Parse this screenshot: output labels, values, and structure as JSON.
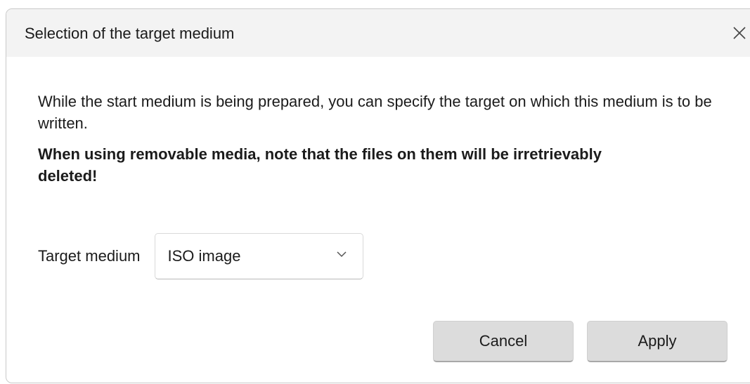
{
  "dialog": {
    "title": "Selection of the target medium",
    "close_icon": "close-icon"
  },
  "content": {
    "info_text": "While the start medium is being prepared, you can specify the target on which this medium is to be written.",
    "warning_text": "When using removable media, note that the files on them will be irretrievably deleted!"
  },
  "target": {
    "label": "Target medium",
    "selected_value": "ISO image",
    "chevron_icon": "chevron-down-icon"
  },
  "buttons": {
    "cancel_label": "Cancel",
    "apply_label": "Apply"
  },
  "colors": {
    "titlebar_bg": "#f3f3f3",
    "button_bg": "#dcdcdc",
    "text": "#1b1b1b"
  }
}
